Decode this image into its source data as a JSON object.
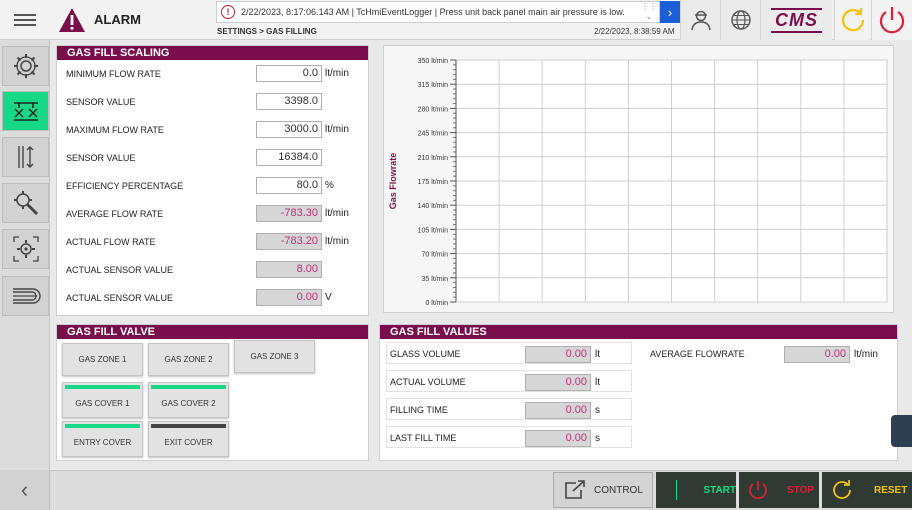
{
  "header": {
    "alarm_label": "ALARM",
    "message": "2/22/2023, 8:17:06.143 AM | TcHmiEventLogger | Press unit back panel main air pressure is low.",
    "breadcrumb": "SETTINGS > GAS FILLING",
    "datetime": "2/22/2023, 8:38:59 AM",
    "brand": "CMS",
    "icons": [
      "menu-icon",
      "warning-icon",
      "user-icon",
      "globe-icon",
      "refresh-icon",
      "power-icon"
    ],
    "accent_color": "#7a0e4d"
  },
  "sidebar": {
    "items": [
      {
        "icon": "gear-icon",
        "active": false
      },
      {
        "icon": "gas-fill-icon",
        "active": true
      },
      {
        "icon": "sort-icon",
        "active": false
      },
      {
        "icon": "tools-icon",
        "active": false
      },
      {
        "icon": "cog-target-icon",
        "active": false
      },
      {
        "icon": "conveyor-icon",
        "active": false
      }
    ]
  },
  "scaling": {
    "title": "GAS FILL SCALING",
    "rows": [
      {
        "label": "MINIMUM FLOW RATE",
        "value": "0.0",
        "unit": "lt/min",
        "readonly": false
      },
      {
        "label": "SENSOR VALUE",
        "value": "3398.0",
        "unit": "",
        "readonly": false
      },
      {
        "label": "MAXIMUM FLOW RATE",
        "value": "3000.0",
        "unit": "lt/min",
        "readonly": false
      },
      {
        "label": "SENSOR VALUE",
        "value": "16384.0",
        "unit": "",
        "readonly": false
      },
      {
        "label": "EFFICIENCY PERCENTAGE",
        "value": "80.0",
        "unit": "%",
        "readonly": false
      },
      {
        "label": "AVERAGE FLOW RATE",
        "value": "-783.30",
        "unit": "lt/min",
        "readonly": true
      },
      {
        "label": "ACTUAL FLOW RATE",
        "value": "-783.20",
        "unit": "lt/min",
        "readonly": true
      },
      {
        "label": "ACTUAL SENSOR VALUE",
        "value": "8.00",
        "unit": "",
        "readonly": true
      },
      {
        "label": "ACTUAL SENSOR VALUE",
        "value": "0.00",
        "unit": "V",
        "readonly": true
      }
    ]
  },
  "chart_data": {
    "type": "line",
    "ylabel": "Gas Flowrate",
    "xlabel": "",
    "ylim": [
      0,
      350
    ],
    "yticks": [
      "0 lt/min",
      "35 lt/min",
      "70 lt/min",
      "105 lt/min",
      "140 lt/min",
      "175 lt/min",
      "210 lt/min",
      "245 lt/min",
      "280 lt/min",
      "315 lt/min",
      "350 lt/min"
    ],
    "series": [],
    "grid": true
  },
  "valve": {
    "title": "GAS FILL VALVE",
    "buttons": [
      {
        "label": "GAS ZONE 1",
        "indicator": ""
      },
      {
        "label": "GAS ZONE 2",
        "indicator": ""
      },
      {
        "label": "GAS ZONE 3",
        "indicator": ""
      },
      {
        "label": "GAS COVER 1",
        "indicator": "#17d887"
      },
      {
        "label": "GAS COVER 2",
        "indicator": "#17d887"
      },
      {
        "label": "ENTRY COVER",
        "indicator": "#17d887"
      },
      {
        "label": "EXIT COVER",
        "indicator": "#444444"
      }
    ]
  },
  "values": {
    "title": "GAS FILL VALUES",
    "rows": [
      {
        "label": "GLASS VOLUME",
        "value": "0.00",
        "unit": "lt"
      },
      {
        "label": "ACTUAL VOLUME",
        "value": "0.00",
        "unit": "lt"
      },
      {
        "label": "FILLING TIME",
        "value": "0.00",
        "unit": "s"
      },
      {
        "label": "LAST FILL TIME",
        "value": "0.00",
        "unit": "s"
      }
    ],
    "average": {
      "label": "AVERAGE FLOWRATE",
      "value": "0.00",
      "unit": "lt/min"
    }
  },
  "footer": {
    "control_label": "CONTROL",
    "start_label": "START",
    "stop_label": "STOP",
    "reset_label": "RESET",
    "colors": {
      "start": "#17d887",
      "stop": "#d8203a",
      "reset": "#f4c20d"
    }
  }
}
